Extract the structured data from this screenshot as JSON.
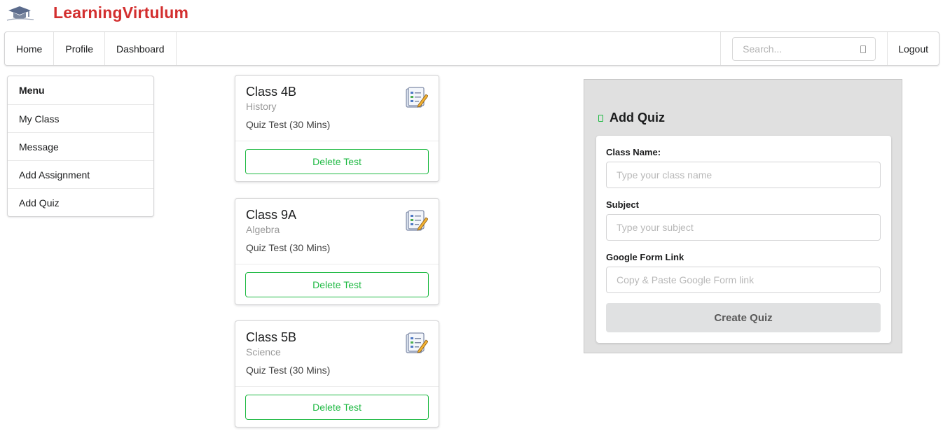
{
  "brand": {
    "name": "LearningVirtulum",
    "logo_icon": "graduation-cap-logo",
    "color": "#d32f2f"
  },
  "topnav": {
    "items": [
      {
        "label": "Home"
      },
      {
        "label": "Profile"
      },
      {
        "label": "Dashboard"
      }
    ],
    "search": {
      "placeholder": "Search...",
      "icon": "search-icon"
    },
    "logout_label": "Logout"
  },
  "sidemenu": {
    "header": "Menu",
    "items": [
      {
        "label": "My Class"
      },
      {
        "label": "Message"
      },
      {
        "label": "Add Assignment"
      },
      {
        "label": "Add Quiz"
      }
    ]
  },
  "cards": [
    {
      "title": "Class 4B",
      "subject": "History",
      "desc": "Quiz Test (30 Mins)",
      "button": "Delete Test",
      "icon": "quiz-checklist-icon"
    },
    {
      "title": "Class 9A",
      "subject": "Algebra",
      "desc": "Quiz Test (30 Mins)",
      "button": "Delete Test",
      "icon": "quiz-checklist-icon"
    },
    {
      "title": "Class 5B",
      "subject": "Science",
      "desc": "Quiz Test (30 Mins)",
      "button": "Delete Test",
      "icon": "quiz-checklist-icon"
    }
  ],
  "add_quiz": {
    "title": "Add Quiz",
    "fields": [
      {
        "label": "Class Name:",
        "placeholder": "Type your class name",
        "value": ""
      },
      {
        "label": "Subject",
        "placeholder": "Type your subject",
        "value": ""
      },
      {
        "label": "Google Form Link",
        "placeholder": "Copy & Paste Google Form link",
        "value": ""
      }
    ],
    "submit_label": "Create Quiz"
  },
  "colors": {
    "accent_green": "#21ba45",
    "brand_red": "#d32f2f",
    "panel_bg": "#e0e0e0"
  }
}
